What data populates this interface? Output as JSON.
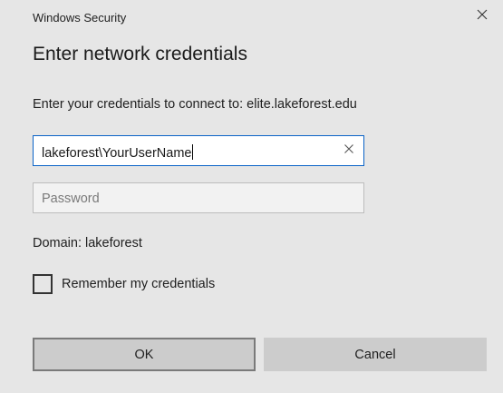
{
  "window": {
    "app_title": "Windows Security",
    "close_icon": "close-icon"
  },
  "dialog": {
    "heading": "Enter network credentials",
    "prompt": "Enter your credentials to connect to: elite.lakeforest.edu"
  },
  "username_field": {
    "value": "lakeforest\\YourUserName",
    "clear_icon": "clear-icon",
    "focused": true
  },
  "password_field": {
    "value": "",
    "placeholder": "Password"
  },
  "domain_text": "Domain: lakeforest",
  "remember": {
    "label": "Remember my credentials",
    "checked": false
  },
  "buttons": {
    "ok_label": "OK",
    "cancel_label": "Cancel"
  },
  "colors": {
    "background": "#e6e6e6",
    "focus_border": "#0a63c7",
    "button_face": "#cccccc",
    "default_button_border": "#7a7a7a"
  }
}
